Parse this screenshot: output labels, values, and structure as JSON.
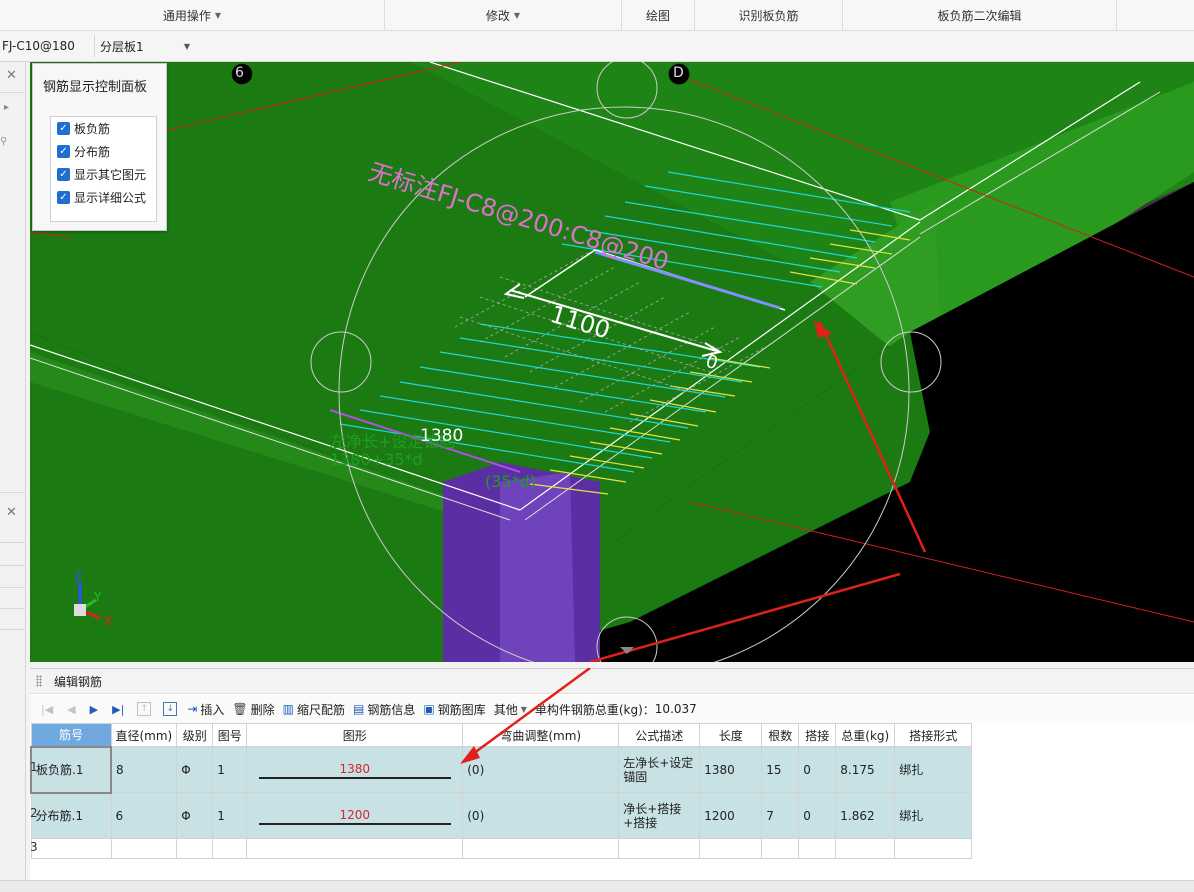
{
  "ribbon": {
    "groups": [
      {
        "label": "通用操作",
        "dropdown": true
      },
      {
        "label": "修改",
        "dropdown": true
      },
      {
        "label": "绘图",
        "dropdown": false
      },
      {
        "label": "识别板负筋",
        "dropdown": false
      },
      {
        "label": "板负筋二次编辑",
        "dropdown": false
      }
    ]
  },
  "subbar": {
    "rebar_combo": "FJ-C10@180",
    "layer_combo": "分层板1"
  },
  "viewport": {
    "axis_labels": {
      "grid_6": "6",
      "grid_D": "D"
    },
    "annotation_main": "无标注FJ-C8@200:C8@200",
    "dimension_length": "1100",
    "dimension_zero": "0",
    "formula_label_1": "左净长+设定锚固",
    "formula_label_2": "1380+35*d",
    "length_1380": "1380",
    "anchor_label": "(35*d)",
    "axes": {
      "x": "X",
      "y": "Y",
      "z": "Z"
    },
    "colors": {
      "slab": "#1a7a12",
      "column": "#5b2fa3",
      "bars_cyan": "#20d8d8",
      "bars_yellow": "#e8e040",
      "annotation": "#e070d0",
      "arrow": "#e0201a"
    }
  },
  "control_panel": {
    "title": "钢筋显示控制面板",
    "options": [
      {
        "label": "板负筋",
        "checked": true
      },
      {
        "label": "分布筋",
        "checked": true
      },
      {
        "label": "显示其它图元",
        "checked": true
      },
      {
        "label": "显示详细公式",
        "checked": true
      }
    ]
  },
  "edit_panel": {
    "title": "编辑钢筋",
    "toolbar": {
      "insert": "插入",
      "delete": "删除",
      "scale_rebar": "缩尺配筋",
      "rebar_info": "钢筋信息",
      "rebar_library": "钢筋图库",
      "other": "其他",
      "total_weight_label": "单构件钢筋总重(kg)：",
      "total_weight_value": "10.037"
    },
    "columns": [
      "筋号",
      "直径(mm)",
      "级别",
      "图号",
      "图形",
      "弯曲调整(mm)",
      "公式描述",
      "长度",
      "根数",
      "搭接",
      "总重(kg)",
      "搭接形式"
    ],
    "rows": [
      {
        "no": "1",
        "name": "板负筋.1",
        "diameter": "8",
        "grade": "Φ",
        "figure": "1",
        "shape_value": "1380",
        "bend": "(0)",
        "formula": "左净长+设定锚固",
        "length": "1380",
        "count": "15",
        "lap": "0",
        "weight": "8.175",
        "lap_type": "绑扎"
      },
      {
        "no": "2",
        "name": "分布筋.1",
        "diameter": "6",
        "grade": "Φ",
        "figure": "1",
        "shape_value": "1200",
        "bend": "(0)",
        "formula": "净长+搭接+搭接",
        "length": "1200",
        "count": "7",
        "lap": "0",
        "weight": "1.862",
        "lap_type": "绑扎"
      }
    ],
    "empty_row_no": "3"
  }
}
